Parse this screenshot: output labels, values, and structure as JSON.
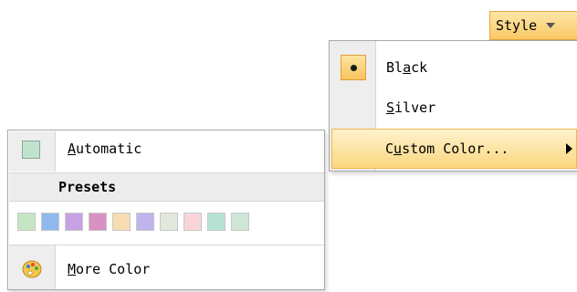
{
  "style_button": {
    "label": "Style"
  },
  "style_menu": {
    "items": [
      {
        "label": "Black",
        "underline_index": 2,
        "selected": true
      },
      {
        "label": "Silver",
        "underline_index": 0,
        "selected": false
      },
      {
        "label": "Custom Color...",
        "underline_index": 1,
        "has_submenu": true,
        "highlighted": true
      }
    ]
  },
  "color_panel": {
    "automatic_label": "Automatic",
    "automatic_color": "#bfe3cc",
    "presets_header": "Presets",
    "preset_colors": [
      "#c4e6c4",
      "#8fb9ec",
      "#c6a2e2",
      "#d991c4",
      "#f6dcb0",
      "#c0b3ee",
      "#e2e9dc",
      "#f8d6d8",
      "#b6e2d4",
      "#cfe6d4"
    ],
    "more_color_label": "More Color"
  },
  "colors": {
    "accent_gradient_top": "#fde7a8",
    "accent_gradient_bottom": "#f9c865",
    "accent_border": "#e3a53a",
    "gutter": "#eeeeee"
  }
}
